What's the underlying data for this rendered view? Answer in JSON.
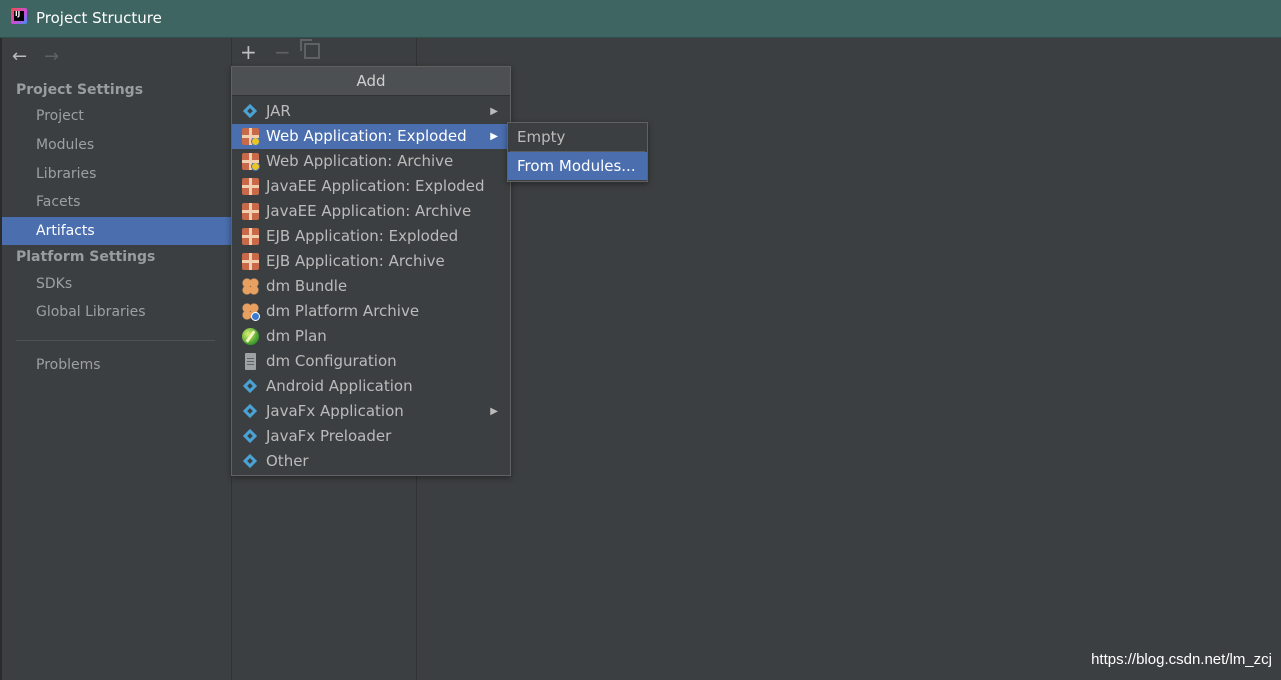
{
  "window": {
    "title": "Project Structure"
  },
  "nav": {
    "back": "←",
    "forward": "→"
  },
  "sidebar": {
    "project_settings_title": "Project Settings",
    "project_settings_items": [
      "Project",
      "Modules",
      "Libraries",
      "Facets",
      "Artifacts"
    ],
    "selected_item": "Artifacts",
    "platform_settings_title": "Platform Settings",
    "platform_settings_items": [
      "SDKs",
      "Global Libraries"
    ],
    "problems": "Problems"
  },
  "toolbar": {
    "add": "+",
    "remove": "−"
  },
  "add_menu": {
    "header": "Add",
    "items": [
      {
        "label": "JAR",
        "icon": "diamond-icon",
        "has_submenu": true
      },
      {
        "label": "Web Application: Exploded",
        "icon": "web-app-icon",
        "has_submenu": true,
        "selected": true
      },
      {
        "label": "Web Application: Archive",
        "icon": "web-app-icon"
      },
      {
        "label": "JavaEE Application: Exploded",
        "icon": "javaee-icon"
      },
      {
        "label": "JavaEE Application: Archive",
        "icon": "javaee-icon"
      },
      {
        "label": "EJB Application: Exploded",
        "icon": "ejb-icon"
      },
      {
        "label": "EJB Application: Archive",
        "icon": "ejb-icon"
      },
      {
        "label": "dm Bundle",
        "icon": "bundle-icon"
      },
      {
        "label": "dm Platform Archive",
        "icon": "bundle-icon"
      },
      {
        "label": "dm Plan",
        "icon": "plan-icon"
      },
      {
        "label": "dm Configuration",
        "icon": "document-icon"
      },
      {
        "label": "Android Application",
        "icon": "diamond-icon"
      },
      {
        "label": "JavaFx Application",
        "icon": "diamond-icon",
        "has_submenu": true
      },
      {
        "label": "JavaFx Preloader",
        "icon": "diamond-icon"
      },
      {
        "label": "Other",
        "icon": "diamond-icon"
      }
    ],
    "submenu_arrow": "▶"
  },
  "submenu": {
    "items": [
      "Empty",
      "From Modules..."
    ],
    "selected": "From Modules..."
  },
  "watermark": "https://blog.csdn.net/lm_zcj",
  "colors": {
    "selection": "#4b6eaf",
    "titlebar": "#3e6561",
    "panel": "#3c3f41"
  }
}
